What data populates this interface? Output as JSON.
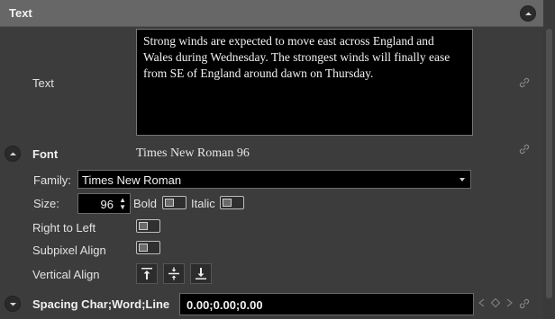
{
  "header": {
    "title": "Text"
  },
  "text_field": {
    "label": "Text",
    "value": "Strong winds are expected to move east across England and Wales during Wednesday. The strongest winds will finally ease from SE of England around dawn on Thursday."
  },
  "font": {
    "label": "Font",
    "summary": "Times New Roman 96",
    "family_label": "Family:",
    "family_value": "Times New Roman",
    "size_label": "Size:",
    "size_value": "96",
    "bold_label": "Bold",
    "italic_label": "Italic"
  },
  "options": {
    "rtl_label": "Right to Left",
    "subpixel_label": "Subpixel Align",
    "vertical_align_label": "Vertical Align"
  },
  "spacing": {
    "label": "Spacing Char;Word;Line",
    "value": "0.00;0.00;0.00"
  },
  "icons": {
    "collapse": "chevron-up-icon",
    "link": "link-icon",
    "align_top": "align-top-icon",
    "align_center": "align-center-icon",
    "align_bottom": "align-bottom-icon"
  },
  "colors": {
    "background": "#3c3c3c",
    "header": "#676767",
    "field": "#000000"
  }
}
